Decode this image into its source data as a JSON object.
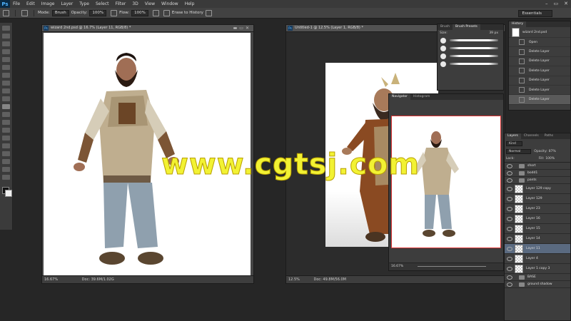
{
  "app": {
    "logo": "Ps",
    "menu": [
      "File",
      "Edit",
      "Image",
      "Layer",
      "Type",
      "Select",
      "Filter",
      "3D",
      "View",
      "Window",
      "Help"
    ],
    "window_controls": [
      "–",
      "▭",
      "✕"
    ]
  },
  "options": {
    "mode_label": "Mode:",
    "mode_value": "Brush",
    "opacity_label": "Opacity:",
    "opacity_value": "100%",
    "flow_label": "Flow:",
    "flow_value": "100%",
    "erase_history": "Erase to History",
    "workspace": "Essentials"
  },
  "doc1": {
    "tab": "wizard 2nd.psd @ 16.7% (Layer 11, RGB/8) *",
    "zoom": "16.67%",
    "info": "Doc: 39.6M/1.02G"
  },
  "doc2": {
    "tab": "Untitled-1 @ 12.5% (Layer 1, RGB/8) *",
    "zoom": "12.5%",
    "info": "Doc: 49.8M/56.0M"
  },
  "navigator": {
    "tabs": [
      "Navigator",
      "Histogram"
    ],
    "zoom": "16.67%"
  },
  "brush": {
    "tabs": [
      "Brush",
      "Brush Presets"
    ],
    "size_label": "Size:",
    "size_value": "39 px"
  },
  "history": {
    "title": "History",
    "snapshot": "wizard 2nd.psd",
    "items": [
      "Open",
      "Delete Layer",
      "Delete Layer",
      "Delete Layer",
      "Delete Layer",
      "Delete Layer",
      "Delete Layer"
    ]
  },
  "layers": {
    "tabs": [
      "Layers",
      "Channels",
      "Paths"
    ],
    "kind": "Kind",
    "blend": "Normal",
    "opacity_label": "Opacity:",
    "opacity_value": "87%",
    "lock_label": "Lock:",
    "fill_label": "Fill:",
    "fill_value": "100%",
    "rows": [
      {
        "name": "short",
        "type": "folder"
      },
      {
        "name": "bodd1",
        "type": "folder"
      },
      {
        "name": "pants",
        "type": "folder"
      },
      {
        "name": "Layer 129 copy",
        "type": "layer"
      },
      {
        "name": "Layer 129",
        "type": "layer"
      },
      {
        "name": "Layer 23",
        "type": "layer"
      },
      {
        "name": "Layer 16",
        "type": "layer"
      },
      {
        "name": "Layer 15",
        "type": "layer"
      },
      {
        "name": "Layer 14",
        "type": "layer"
      },
      {
        "name": "Layer 11",
        "type": "layer",
        "selected": true
      },
      {
        "name": "Layer 4",
        "type": "layer"
      },
      {
        "name": "Layer 1 copy 3",
        "type": "layer"
      },
      {
        "name": "BASE",
        "type": "folder"
      },
      {
        "name": "ground shadow",
        "type": "folder"
      }
    ]
  },
  "watermark": "www.cgtsj.com"
}
